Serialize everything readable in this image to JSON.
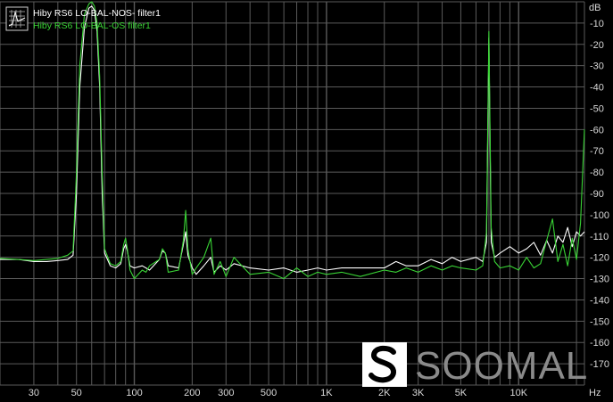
{
  "chart_data": {
    "type": "line",
    "xlabel": "Hz",
    "ylabel": "dB",
    "xscale": "log",
    "xlim": [
      20,
      22000
    ],
    "ylim": [
      -180,
      0
    ],
    "grid": true,
    "legend_position": "top-left",
    "background_color": "#000000",
    "grid_color": "#5a5a5a",
    "x_ticks": [
      {
        "value": 30,
        "label": "30"
      },
      {
        "value": 50,
        "label": "50"
      },
      {
        "value": 100,
        "label": "100"
      },
      {
        "value": 200,
        "label": "200"
      },
      {
        "value": 300,
        "label": "300"
      },
      {
        "value": 500,
        "label": "500"
      },
      {
        "value": 1000,
        "label": "1K"
      },
      {
        "value": 2000,
        "label": "2K"
      },
      {
        "value": 3000,
        "label": "3K"
      },
      {
        "value": 5000,
        "label": "5K"
      },
      {
        "value": 10000,
        "label": "10K"
      }
    ],
    "y_ticks": [
      -10,
      -20,
      -30,
      -40,
      -50,
      -60,
      -70,
      -80,
      -90,
      -100,
      -110,
      -120,
      -130,
      -140,
      -150,
      -160,
      -170
    ],
    "series": [
      {
        "name": "Hiby RS6 LO-BAL-NOS- filter1",
        "color": "#ffffff",
        "points": [
          [
            20,
            -121
          ],
          [
            25,
            -121
          ],
          [
            30,
            -122
          ],
          [
            35,
            -122
          ],
          [
            40,
            -121.5
          ],
          [
            45,
            -121
          ],
          [
            48,
            -119
          ],
          [
            50,
            -90
          ],
          [
            52,
            -40
          ],
          [
            55,
            -12
          ],
          [
            58,
            -3
          ],
          [
            60,
            -2
          ],
          [
            62,
            -4
          ],
          [
            64,
            -14
          ],
          [
            66,
            -40
          ],
          [
            68,
            -90
          ],
          [
            70,
            -118
          ],
          [
            75,
            -124
          ],
          [
            80,
            -125
          ],
          [
            85,
            -123
          ],
          [
            88,
            -116
          ],
          [
            90,
            -114
          ],
          [
            92,
            -117
          ],
          [
            95,
            -124
          ],
          [
            100,
            -125
          ],
          [
            110,
            -124
          ],
          [
            115,
            -125
          ],
          [
            120,
            -126
          ],
          [
            135,
            -121
          ],
          [
            140,
            -117
          ],
          [
            145,
            -118
          ],
          [
            150,
            -124
          ],
          [
            170,
            -125
          ],
          [
            180,
            -114
          ],
          [
            185,
            -108
          ],
          [
            190,
            -119
          ],
          [
            200,
            -125
          ],
          [
            210,
            -128
          ],
          [
            230,
            -124
          ],
          [
            250,
            -120
          ],
          [
            260,
            -127
          ],
          [
            280,
            -124
          ],
          [
            300,
            -126
          ],
          [
            330,
            -123
          ],
          [
            400,
            -125
          ],
          [
            500,
            -126
          ],
          [
            600,
            -125
          ],
          [
            700,
            -127
          ],
          [
            800,
            -126
          ],
          [
            900,
            -125
          ],
          [
            1000,
            -126
          ],
          [
            1200,
            -125
          ],
          [
            1500,
            -125
          ],
          [
            2000,
            -125
          ],
          [
            2300,
            -122
          ],
          [
            2600,
            -124
          ],
          [
            3000,
            -124
          ],
          [
            3500,
            -121
          ],
          [
            4000,
            -123
          ],
          [
            4500,
            -120
          ],
          [
            5000,
            -122
          ],
          [
            6000,
            -120
          ],
          [
            6500,
            -122
          ],
          [
            6800,
            -113
          ],
          [
            7000,
            -17
          ],
          [
            7200,
            -113
          ],
          [
            7500,
            -120
          ],
          [
            8000,
            -118
          ],
          [
            9000,
            -115
          ],
          [
            10000,
            -118
          ],
          [
            11000,
            -116
          ],
          [
            12000,
            -113
          ],
          [
            13000,
            -119
          ],
          [
            14000,
            -112
          ],
          [
            15000,
            -118
          ],
          [
            16000,
            -110
          ],
          [
            17000,
            -113
          ],
          [
            18000,
            -106
          ],
          [
            19000,
            -115
          ],
          [
            20000,
            -108
          ],
          [
            21000,
            -110
          ],
          [
            22000,
            -108
          ]
        ]
      },
      {
        "name": "Hiby RS6 LO-BAL-OS filter1",
        "color": "#39d435",
        "points": [
          [
            20,
            -120.5
          ],
          [
            25,
            -121
          ],
          [
            30,
            -121.5
          ],
          [
            35,
            -121
          ],
          [
            40,
            -120.5
          ],
          [
            45,
            -119
          ],
          [
            48,
            -117
          ],
          [
            50,
            -80
          ],
          [
            52,
            -30
          ],
          [
            55,
            -6
          ],
          [
            58,
            -1
          ],
          [
            60,
            0
          ],
          [
            62,
            -2
          ],
          [
            64,
            -10
          ],
          [
            66,
            -35
          ],
          [
            68,
            -80
          ],
          [
            70,
            -116
          ],
          [
            75,
            -123
          ],
          [
            80,
            -124
          ],
          [
            85,
            -122
          ],
          [
            88,
            -114
          ],
          [
            90,
            -111
          ],
          [
            92,
            -116
          ],
          [
            95,
            -126
          ],
          [
            100,
            -130
          ],
          [
            110,
            -126
          ],
          [
            115,
            -127
          ],
          [
            120,
            -124
          ],
          [
            135,
            -121
          ],
          [
            140,
            -116
          ],
          [
            145,
            -118
          ],
          [
            150,
            -127
          ],
          [
            170,
            -126
          ],
          [
            180,
            -112
          ],
          [
            185,
            -98
          ],
          [
            190,
            -116
          ],
          [
            200,
            -128
          ],
          [
            210,
            -125
          ],
          [
            230,
            -120
          ],
          [
            250,
            -111
          ],
          [
            260,
            -128
          ],
          [
            280,
            -122
          ],
          [
            300,
            -129
          ],
          [
            330,
            -120
          ],
          [
            400,
            -128
          ],
          [
            500,
            -127
          ],
          [
            600,
            -130
          ],
          [
            700,
            -125
          ],
          [
            800,
            -129
          ],
          [
            900,
            -127
          ],
          [
            1000,
            -128
          ],
          [
            1200,
            -127
          ],
          [
            1500,
            -129
          ],
          [
            2000,
            -126
          ],
          [
            2300,
            -127
          ],
          [
            2600,
            -125
          ],
          [
            3000,
            -127
          ],
          [
            3500,
            -124
          ],
          [
            4000,
            -126
          ],
          [
            4500,
            -124
          ],
          [
            5000,
            -125
          ],
          [
            6000,
            -126
          ],
          [
            6500,
            -124
          ],
          [
            6800,
            -108
          ],
          [
            7000,
            -14
          ],
          [
            7200,
            -106
          ],
          [
            7500,
            -122
          ],
          [
            8000,
            -125
          ],
          [
            9000,
            -124
          ],
          [
            10000,
            -126
          ],
          [
            11000,
            -120
          ],
          [
            12000,
            -125
          ],
          [
            13000,
            -123
          ],
          [
            14000,
            -112
          ],
          [
            15000,
            -102
          ],
          [
            16000,
            -122
          ],
          [
            17000,
            -114
          ],
          [
            18000,
            -124
          ],
          [
            19000,
            -111
          ],
          [
            20000,
            -121
          ],
          [
            21000,
            -104
          ],
          [
            22000,
            -60
          ]
        ]
      }
    ]
  },
  "watermark": {
    "logo_icon": "soomal-s-logo-icon",
    "text": "SOOMAL",
    "text_color": "#8a8a8a"
  }
}
